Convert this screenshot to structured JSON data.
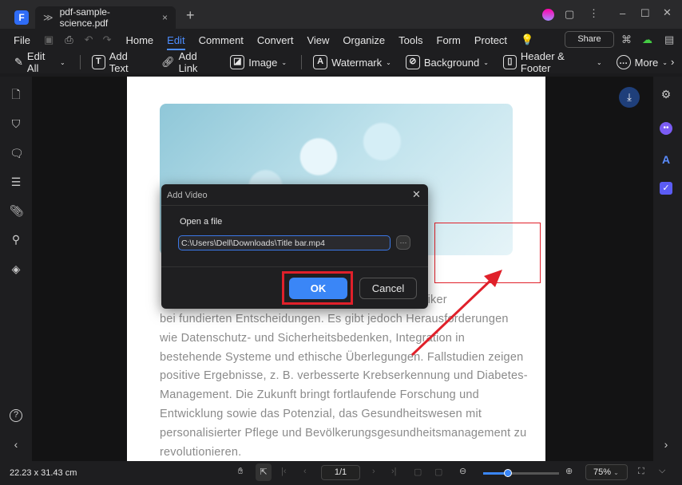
{
  "app": {
    "tab_title": "pdf-sample-science.pdf",
    "logo": "F"
  },
  "menu": {
    "items": [
      "File",
      "Home",
      "Edit",
      "Comment",
      "Convert",
      "View",
      "Organize",
      "Tools",
      "Form",
      "Protect"
    ],
    "active": "Edit",
    "share": "Share"
  },
  "toolbar": {
    "items": [
      "Edit All",
      "Add Text",
      "Add Link",
      "Image",
      "Watermark",
      "Background",
      "Header & Footer",
      "More"
    ]
  },
  "document": {
    "lines": [
      "terstützt Kliniker",
      "bei fundierten Entscheidungen.   Es gibt jedoch Herausforderungen",
      "wie Datenschutz- und Sicherheitsbedenken, Integration in",
      "bestehende Systeme und ethische Überlegungen. Fallstudien zeigen",
      "positive Ergebnisse, z. B.   verbesserte Krebserkennung und Diabetes-",
      "Management. Die Zukunft bringt fortlaufende Forschung   und",
      "Entwicklung sowie das Potenzial, das Gesundheitswesen mit",
      "personalisierter Pflege und Bevölkerungsgesundheitsmanagement zu",
      "revolutionieren."
    ]
  },
  "dialog": {
    "title": "Add Video",
    "label": "Open a file",
    "path": "C:\\Users\\Dell\\Downloads\\Title bar.mp4",
    "browse": "···",
    "ok": "OK",
    "cancel": "Cancel"
  },
  "status": {
    "dimensions": "22.23 x 31.43 cm",
    "page": "1/1",
    "zoom": "75%",
    "zoom_slider_fraction": 0.33
  },
  "colors": {
    "accent": "#4c8dff",
    "highlight": "#e0202a"
  }
}
